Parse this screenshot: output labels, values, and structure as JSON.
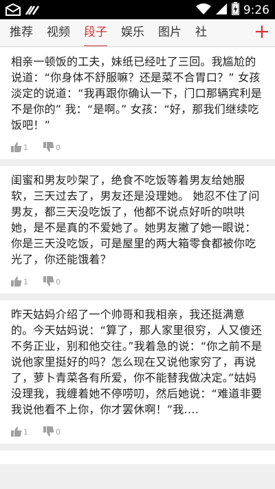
{
  "statusbar": {
    "time": "9:26",
    "left_icons": [
      "mail-icon",
      "signal-tools-icon"
    ],
    "right_icons": [
      "wifi-icon",
      "cell-signal-icon",
      "battery-icon"
    ]
  },
  "tabs": {
    "items": [
      {
        "label": "推荐"
      },
      {
        "label": "视频"
      },
      {
        "label": "段子"
      },
      {
        "label": "娱乐"
      },
      {
        "label": "图片"
      },
      {
        "label": "社"
      }
    ],
    "active_index": 2,
    "add_icon": "plus-icon",
    "accent_color": "#d33232"
  },
  "feed": [
    {
      "text": "相亲一顿饭的工夫，妹纸已经吐了三回。我尴尬的说道：“你身体不舒服嘛？还是菜不合胃口？” 女孩淡定的说道：“我再跟你确认一下，门口那辆宾利是不是你的” 我：“是啊。” 女孩：“好，那我们继续吃饭吧！”",
      "likes": "1",
      "dislikes": "0"
    },
    {
      "text": "闺蜜和男友吵架了，绝食不吃饭等着男友给她服软，三天过去了，男友还是没理她。 她忍不住了问男友，都三天没吃饭了，他都不说点好听的哄哄她，是不是真的不爱她了。她男友撇了她一眼说：你是三天没吃饭，可是屋里的两大箱零食都被你吃光了，你还能饿着？",
      "likes": "1",
      "dislikes": "0"
    },
    {
      "text": "昨天姑妈介绍了一个帅哥和我相亲，我还挺满意的。今天姑妈说：“算了，那人家里很穷，人又傻还不务正业，别和他交往。”我着急的说：“你之前不是说他家里挺好的吗？怎么现在又说他家穷了，再说了，萝卜青菜各有所爱，你不能替我做决定。”姑妈没理我，我缠着她不停唠叨，然后她说：“难道非要我说他看不上你，你才罢休啊！”我….",
      "likes": "1",
      "dislikes": "0"
    }
  ]
}
